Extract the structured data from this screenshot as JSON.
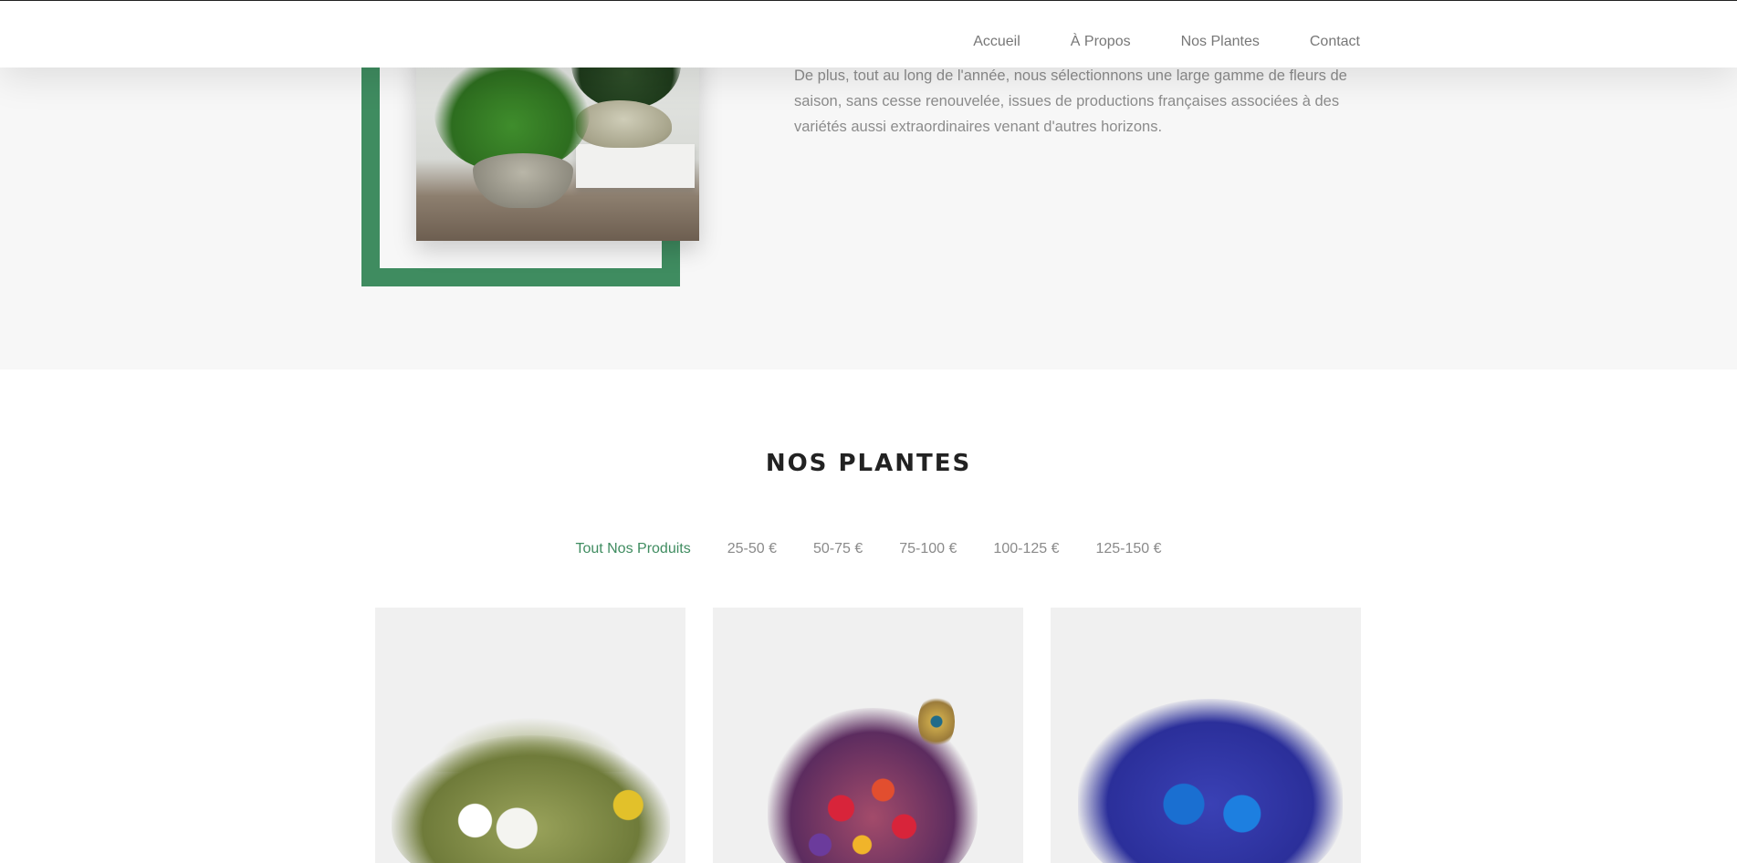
{
  "nav": {
    "items": [
      {
        "label": "Accueil"
      },
      {
        "label": "À Propos"
      },
      {
        "label": "Nos Plantes"
      },
      {
        "label": "Contact"
      }
    ]
  },
  "about": {
    "paragraph": "De plus, tout au long de l'année, nous sélectionnons une large gamme de fleurs de saison, sans cesse renouvelée, issues de productions françaises associées à des variétés aussi extraordinaires venant d'autres horizons."
  },
  "products": {
    "title": "NOS PLANTES",
    "filters": [
      {
        "label": "Tout Nos Produits",
        "active": true
      },
      {
        "label": "25-50 €",
        "active": false
      },
      {
        "label": "50-75 €",
        "active": false
      },
      {
        "label": "75-100 €",
        "active": false
      },
      {
        "label": "100-125 €",
        "active": false
      },
      {
        "label": "125-150 €",
        "active": false
      }
    ]
  },
  "colors": {
    "accent": "#3f8c60",
    "title": "#222222",
    "muted_text": "#8a8a8a",
    "band_bg": "#f7f7f7"
  }
}
